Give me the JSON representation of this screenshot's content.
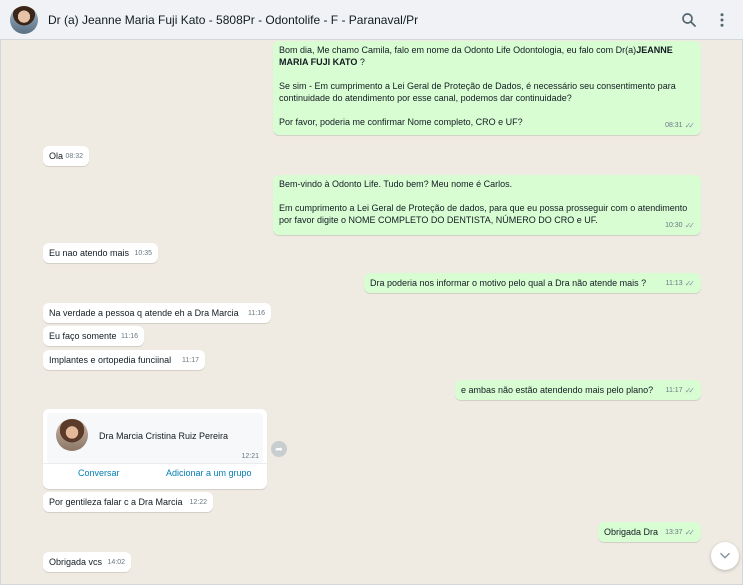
{
  "header": {
    "title": "Dr (a) Jeanne Maria Fuji Kato - 5808Pr - Odontolife - F - Paranaval/Pr",
    "icons": [
      "search-icon",
      "menu-icon"
    ]
  },
  "messages": [
    {
      "id": "m1",
      "dir": "out",
      "text_before_bold": "Bom dia, Me chamo Camila, falo em nome da Odonto Life Odontologia, eu falo com Dr(a)",
      "bold": "JEANNE MARIA FUJI KATO",
      "text_after_bold": " ?\n\nSe sim - Em cumprimento a Lei Geral de Proteção de Dados, é necessário seu consentimento para continuidade do atendimento por esse canal, podemos dar continuidade?\n\nPor favor, poderia me confirmar Nome completo, CRO e UF?",
      "time": "08:31",
      "status": "read"
    },
    {
      "id": "m2",
      "dir": "in",
      "text": "Ola",
      "time": "08:32"
    },
    {
      "id": "m3",
      "dir": "out",
      "text": "Bem-vindo à Odonto Life. Tudo bem? Meu nome é Carlos.\n\nEm cumprimento a Lei Geral de Proteção de dados, para que eu possa prosseguir com o atendimento por favor digite o NOME COMPLETO DO DENTISTA, NÚMERO DO CRO e UF.",
      "time": "10:30",
      "status": "read"
    },
    {
      "id": "m4",
      "dir": "in",
      "text": "Eu nao atendo mais",
      "time": "10:35"
    },
    {
      "id": "m5",
      "dir": "out",
      "text": "Dra poderia nos informar o motivo pelo qual a Dra não atende mais ?",
      "time": "11:13",
      "status": "read"
    },
    {
      "id": "m6",
      "dir": "in",
      "text": "Na verdade a pessoa q atende eh a Dra Marcia",
      "time": "11:16"
    },
    {
      "id": "m7",
      "dir": "in",
      "text": "Eu faço somente",
      "time": "11:16"
    },
    {
      "id": "m8",
      "dir": "in",
      "text": "Implantes e ortopedia funciinal",
      "time": "11:17"
    },
    {
      "id": "m9",
      "dir": "out",
      "text": "e ambas não estão atendendo mais pelo plano?",
      "time": "11:17",
      "status": "read"
    },
    {
      "id": "m11",
      "dir": "in",
      "text": "Por gentileza falar c a Dra Marcia",
      "time": "12:22"
    },
    {
      "id": "m12",
      "dir": "out",
      "text": "Obrigada Dra",
      "time": "13:37",
      "status": "read"
    },
    {
      "id": "m13",
      "dir": "in",
      "text": "Obrigada vcs",
      "time": "14:02"
    }
  ],
  "contact_card": {
    "name": "Dra Marcia Cristina Ruiz Pereira",
    "time": "12:21",
    "actions": [
      "Conversar",
      "Adicionar a um grupo"
    ]
  },
  "colors": {
    "outgoing_bubble": "#d9fdd3",
    "incoming_bubble": "#ffffff",
    "chat_background": "#efeae2",
    "link": "#027eb5"
  }
}
